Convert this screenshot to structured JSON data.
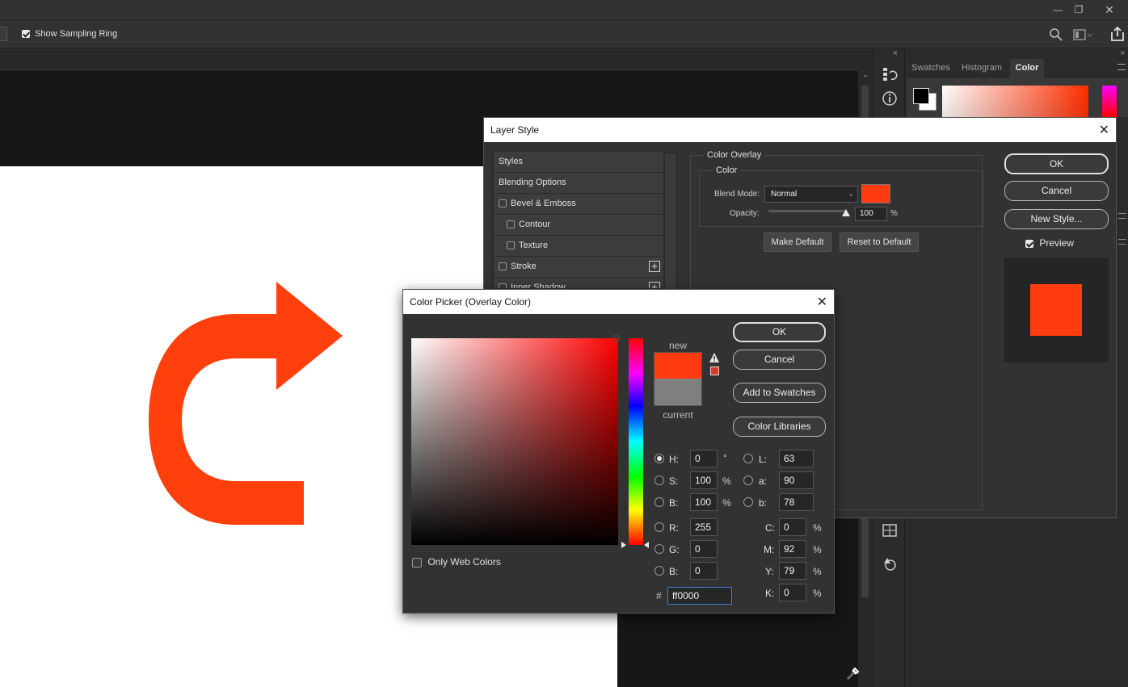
{
  "options_bar": {
    "sampling_ring_label": "Show Sampling Ring"
  },
  "panels": {
    "tabs": [
      {
        "label": "Swatches",
        "active": false
      },
      {
        "label": "Histogram",
        "active": false
      },
      {
        "label": "Color",
        "active": true
      }
    ]
  },
  "artwork": {
    "arrow_color": "#ff400d"
  },
  "layer_style": {
    "title": "Layer Style",
    "styles_list": [
      {
        "label": "Styles",
        "checkbox": false,
        "indent": false,
        "plus": false
      },
      {
        "label": "Blending Options",
        "checkbox": false,
        "indent": false,
        "plus": false
      },
      {
        "label": "Bevel & Emboss",
        "checkbox": true,
        "indent": false,
        "plus": false
      },
      {
        "label": "Contour",
        "checkbox": true,
        "indent": true,
        "plus": false
      },
      {
        "label": "Texture",
        "checkbox": true,
        "indent": true,
        "plus": false
      },
      {
        "label": "Stroke",
        "checkbox": true,
        "indent": false,
        "plus": true
      },
      {
        "label": "Inner Shadow",
        "checkbox": true,
        "indent": false,
        "plus": true
      }
    ],
    "section_title": "Color Overlay",
    "group_title": "Color",
    "blend_mode_label": "Blend Mode:",
    "blend_mode_value": "Normal",
    "opacity_label": "Opacity:",
    "opacity_value": "100",
    "opacity_unit": "%",
    "opacity_level": 1.0,
    "overlay_color": "#ff3c0f",
    "make_default_label": "Make Default",
    "reset_default_label": "Reset to Default",
    "ok_label": "OK",
    "cancel_label": "Cancel",
    "new_style_label": "New Style...",
    "preview_label": "Preview"
  },
  "color_picker": {
    "title": "Color Picker (Overlay Color)",
    "new_label": "new",
    "current_label": "current",
    "new_color": "#ff3c0f",
    "current_color": "#7f7f7f",
    "ok_label": "OK",
    "cancel_label": "Cancel",
    "add_swatches_label": "Add to Swatches",
    "color_libraries_label": "Color Libraries",
    "only_web_label": "Only Web Colors",
    "hsb": [
      {
        "label": "H:",
        "value": "0",
        "unit": "°",
        "selected": true
      },
      {
        "label": "S:",
        "value": "100",
        "unit": "%",
        "selected": false
      },
      {
        "label": "B:",
        "value": "100",
        "unit": "%",
        "selected": false
      }
    ],
    "lab": [
      {
        "label": "L:",
        "value": "63"
      },
      {
        "label": "a:",
        "value": "90"
      },
      {
        "label": "b:",
        "value": "78"
      }
    ],
    "rgb": [
      {
        "label": "R:",
        "value": "255"
      },
      {
        "label": "G:",
        "value": "0"
      },
      {
        "label": "B:",
        "value": "0"
      }
    ],
    "cmyk": [
      {
        "label": "C:",
        "value": "0",
        "unit": "%"
      },
      {
        "label": "M:",
        "value": "92",
        "unit": "%"
      },
      {
        "label": "Y:",
        "value": "79",
        "unit": "%"
      },
      {
        "label": "K:",
        "value": "0",
        "unit": "%"
      }
    ],
    "hex_label": "#",
    "hex_value": "ff0000"
  }
}
